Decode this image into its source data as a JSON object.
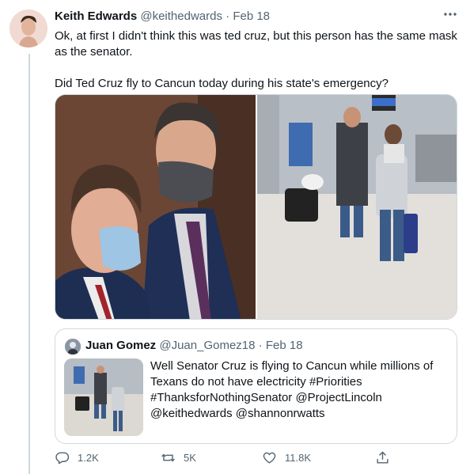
{
  "tweet": {
    "author_name": "Keith Edwards",
    "author_handle": "@keithedwards",
    "separator": "·",
    "date": "Feb 18",
    "more_icon": "ellipsis-icon",
    "text_line1": "Ok, at first I didn't think this was ted cruz, but this person has the same mask as the senator.",
    "text_line2": "Did Ted Cruz fly to Cancun today during his state's emergency?"
  },
  "quote": {
    "author_name": "Juan Gomez",
    "author_handle": "@Juan_Gomez18",
    "separator": "·",
    "date": "Feb 18",
    "text": "Well Senator Cruz is flying to Cancun while millions of Texans do not have electricity #Priorities #ThanksforNothingSenator @ProjectLincoln @keithedwards @shannonrwatts"
  },
  "actions": {
    "reply_count": "1.2K",
    "retweet_count": "5K",
    "like_count": "11.8K",
    "icons": [
      "reply-icon",
      "retweet-icon",
      "like-icon",
      "share-icon"
    ]
  },
  "colors": {
    "text": "#0f1419",
    "secondary": "#536471",
    "border": "#cfd9de"
  }
}
